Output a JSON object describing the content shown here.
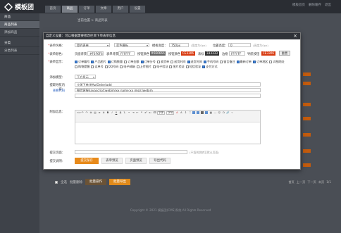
{
  "header": {
    "logo_text": "模板团",
    "tabs": [
      "首页",
      "商品",
      "订单",
      "文章",
      "用户",
      "设置"
    ],
    "active_tab": 1,
    "links": [
      "模板首页",
      "删除缓存",
      "退出"
    ]
  },
  "sidebar": {
    "items": [
      {
        "label": "商品",
        "kind": "head"
      },
      {
        "label": "商品列表",
        "kind": "active"
      },
      {
        "label": "添加商品",
        "kind": "item"
      },
      {
        "label": "分类",
        "kind": "head"
      },
      {
        "label": "分类列表",
        "kind": "item"
      }
    ]
  },
  "breadcrumb": "当前位置 > 商品列表",
  "dialog": {
    "title": "自定义设置：可以根据需要修改栏目下单表单信息",
    "close": "×",
    "row1": {
      "label": "表单风格：",
      "style_value": "简约表单",
      "template_value": "蓝色模板",
      "width_label": "模板宽度：",
      "width_value": "750px",
      "width_hint": "(宽度为0px)",
      "position_label": "位置高度：",
      "position_value": "0",
      "position_hint": "(高度为0px)"
    },
    "row2": {
      "label": "表单颜色：",
      "c1_label": "页面背景",
      "c1_value": "#F6F6F6",
      "c2_label": "表单背景",
      "c2_value": "FFFFFF",
      "c3_label": "按钮颜色",
      "c3_value": "#666666",
      "c4_label": "按钮颜色",
      "c4_value": "CE3306",
      "c5_label": "表标",
      "c5_value": "333333",
      "c6_label": "边框",
      "c6_value": "FFFFFF",
      "c7_label": "导航按钮",
      "c7_value": "CE3306",
      "reset": "重置",
      "orange": "#d83a10",
      "gray": "#666666",
      "dark": "#333333"
    },
    "row3": {
      "label": "表单显示：",
      "options": [
        {
          "text": "订单编号",
          "on": true
        },
        {
          "text": "产品图片",
          "on": true
        },
        {
          "text": "订购数量",
          "on": true
        },
        {
          "text": "订单金额",
          "on": false
        },
        {
          "text": "订单分号",
          "on": true
        },
        {
          "text": "收货单",
          "on": false
        },
        {
          "text": "送货时间",
          "on": false
        },
        {
          "text": "送货时间",
          "on": true
        },
        {
          "text": "手机号码",
          "on": true
        },
        {
          "text": "留言备注",
          "on": false
        },
        {
          "text": "最新订单",
          "on": true
        },
        {
          "text": "订单地区",
          "on": true
        },
        {
          "text": "详细地址",
          "on": false
        },
        {
          "text": "购物提醒",
          "on": false
        },
        {
          "text": "运单号",
          "on": false
        },
        {
          "text": "QQ号码",
          "on": false
        },
        {
          "text": "电子邮箱",
          "on": false
        },
        {
          "text": "上传图片",
          "on": false
        },
        {
          "text": "电子验证",
          "on": false
        },
        {
          "text": "图片验证",
          "on": false
        },
        {
          "text": "短信验证",
          "on": false
        },
        {
          "text": "支付方式",
          "on": true
        }
      ]
    },
    "row4": {
      "label": "添加模型：",
      "value": "下方显示"
    },
    "row5": {
      "label": "提取导航内容：",
      "link_label": "查看代码",
      "line1": "立即下单|#ApiOrder|add",
      "line2": "微信客服|javascript:webim(xx name:xx img);|webim"
    },
    "row6": {
      "label": "附加信息：",
      "toolbar_font": "字体",
      "toolbar_size": "字号"
    },
    "row7": {
      "label": "提交页面：",
      "value": "",
      "hint": "(不填则跳转至默认页面)"
    },
    "row8": {
      "label": "提交说明：",
      "buttons": [
        "提交保存",
        "表单预览",
        "页面预览",
        "导出代码"
      ]
    }
  },
  "listing": {
    "bottom_label": "全选",
    "select_label": "批量删除",
    "btn_update": "批量操作",
    "btn_export": "批量导出",
    "pager": [
      "首页",
      "上一页",
      "下一页",
      "末页",
      "1/1"
    ]
  },
  "footer": "Copyright © 2021 模板团(CMS)系统 All Rights Reserved"
}
